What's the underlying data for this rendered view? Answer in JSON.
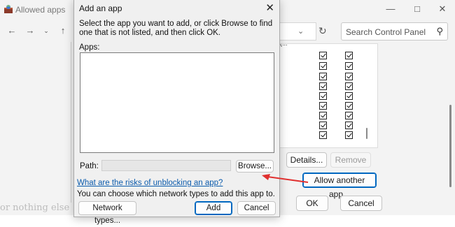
{
  "background_window": {
    "title": "Allowed apps",
    "search_placeholder": "Search Control Panel",
    "list_partial_text": "(...",
    "details_label": "Details...",
    "remove_label": "Remove",
    "allow_another_label": "Allow another app...",
    "ok_label": "OK",
    "cancel_label": "Cancel",
    "footer_text": "or nothing else",
    "checkbox_rows": 10
  },
  "dialog": {
    "title": "Add an app",
    "instruction": "Select the app you want to add, or click Browse to find one that is not listed, and then click OK.",
    "apps_label": "Apps:",
    "path_label": "Path:",
    "path_value": "",
    "browse_label": "Browse...",
    "risk_link": "What are the risks of unblocking an app?",
    "network_note": "You can choose which network types to add this app to.",
    "network_types_label": "Network types...",
    "add_label": "Add",
    "cancel_label": "Cancel"
  },
  "annotation": {
    "arrow_color": "#e0302f"
  }
}
